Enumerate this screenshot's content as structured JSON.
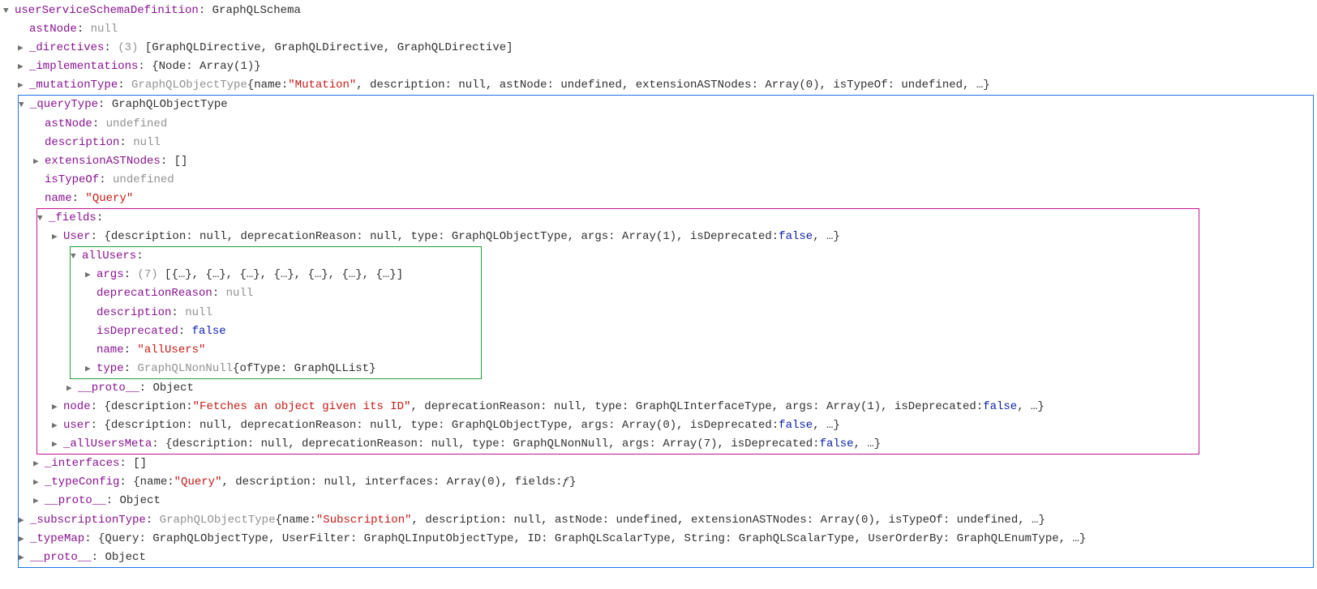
{
  "root": {
    "key": "userServiceSchemaDefinition",
    "type": "GraphQLSchema"
  },
  "top": {
    "astNode": {
      "k": "astNode",
      "v": "null"
    },
    "directives": {
      "k": "_directives",
      "count": "(3)",
      "v": "[GraphQLDirective, GraphQLDirective, GraphQLDirective]"
    },
    "implementations": {
      "k": "_implementations",
      "v": "{Node: Array(1)}"
    },
    "mutationType": {
      "k": "_mutationType",
      "type": "GraphQLObjectType",
      "brace_open": " {",
      "name_k": "name: ",
      "name_v": "\"Mutation\"",
      "rest": ", description: null, astNode: undefined, extensionASTNodes: Array(0), isTypeOf: undefined, …}"
    }
  },
  "queryType": {
    "header": {
      "k": "_queryType",
      "type": "GraphQLObjectType"
    },
    "astNode": {
      "k": "astNode",
      "v": "undefined"
    },
    "description": {
      "k": "description",
      "v": "null"
    },
    "extAST": {
      "k": "extensionASTNodes",
      "v": "[]"
    },
    "isTypeOf": {
      "k": "isTypeOf",
      "v": "undefined"
    },
    "name": {
      "k": "name",
      "v": "\"Query\""
    }
  },
  "fields": {
    "header": {
      "k": "_fields"
    },
    "user": {
      "k": "User",
      "summary": "{description: null, deprecationReason: null, type: GraphQLObjectType, args: Array(1), isDeprecated: ",
      "false": "false",
      "tail": ", …}"
    }
  },
  "allUsers": {
    "header": {
      "k": "allUsers"
    },
    "args": {
      "k": "args",
      "count": "(7)",
      "v": "[{…}, {…}, {…}, {…}, {…}, {…}, {…}]"
    },
    "depr": {
      "k": "deprecationReason",
      "v": "null"
    },
    "desc": {
      "k": "description",
      "v": "null"
    },
    "isDep": {
      "k": "isDeprecated",
      "v": "false"
    },
    "name": {
      "k": "name",
      "v": "\"allUsers\""
    },
    "type": {
      "k": "type",
      "head": "GraphQLNonNull",
      "rest": " {ofType: GraphQLList}"
    }
  },
  "below_green": {
    "proto": {
      "k": "__proto__",
      "v": "Object"
    },
    "node": {
      "k": "node",
      "pre": "{description: ",
      "str": "\"Fetches an object given its ID\"",
      "mid": ", deprecationReason: null, type: GraphQLInterfaceType, args: Array(1), isDeprecated: ",
      "false": "false",
      "tail": ", …}"
    },
    "user2": {
      "k": "user",
      "summary": "{description: null, deprecationReason: null, type: GraphQLObjectType, args: Array(0), isDeprecated: ",
      "false": "false",
      "tail": ", …}"
    },
    "meta": {
      "k": "_allUsersMeta",
      "summary": "{description: null, deprecationReason: null, type: GraphQLNonNull, args: Array(7), isDeprecated: ",
      "false": "false",
      "tail": ", …}"
    }
  },
  "after_magenta": {
    "interfaces": {
      "k": "_interfaces",
      "v": "[]"
    },
    "typeConfig": {
      "k": "_typeConfig",
      "pre": "{name: ",
      "str": "\"Query\"",
      "mid": ", description: null, interfaces: Array(0), fields: ",
      "italic": "ƒ",
      "tail": "}"
    },
    "proto": {
      "k": "__proto__",
      "v": "Object"
    }
  },
  "bottom": {
    "subscription": {
      "k": "_subscriptionType",
      "type": "GraphQLObjectType",
      "brace_open": " {",
      "name_k": "name: ",
      "name_v": "\"Subscription\"",
      "rest": ", description: null, astNode: undefined, extensionASTNodes: Array(0), isTypeOf: undefined, …}"
    },
    "typeMap": {
      "k": "_typeMap",
      "v": "{Query: GraphQLObjectType, UserFilter: GraphQLInputObjectType, ID: GraphQLScalarType, String: GraphQLScalarType, UserOrderBy: GraphQLEnumType, …}"
    },
    "proto": {
      "k": "__proto__",
      "v": "Object"
    }
  },
  "arrows": {
    "open": "▼",
    "closed": "▶"
  }
}
